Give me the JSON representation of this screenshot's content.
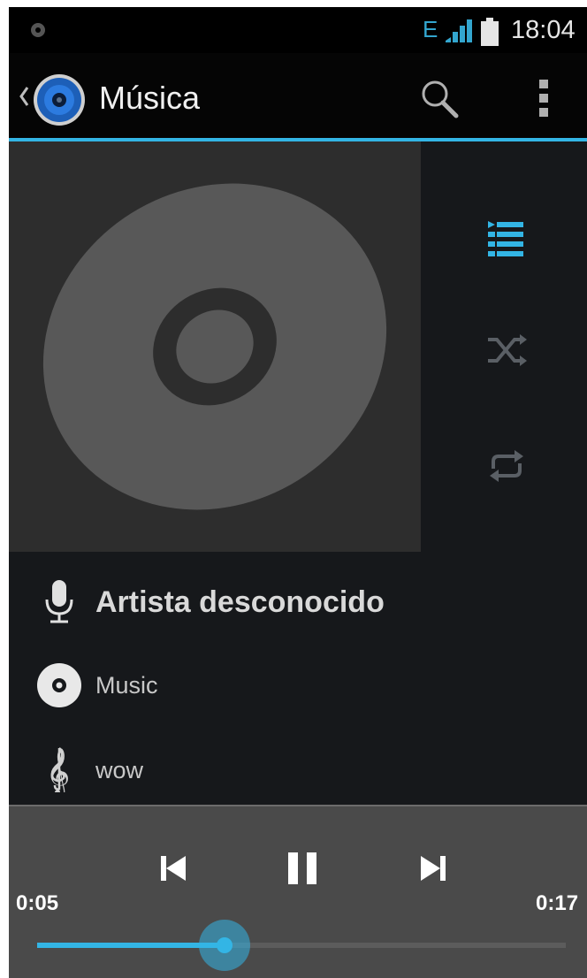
{
  "status_bar": {
    "network_type": "E",
    "time": "18:04"
  },
  "action_bar": {
    "title": "Música",
    "icons": [
      "back-chevron-icon",
      "music-app-icon",
      "search-icon",
      "overflow-menu-icon"
    ]
  },
  "side_controls": {
    "icons": [
      "now-playing-list-icon",
      "shuffle-icon",
      "repeat-icon"
    ]
  },
  "track": {
    "artist": "Artista desconocido",
    "album": "Music",
    "title": "wow"
  },
  "playback": {
    "current_time": "0:05",
    "total_time": "0:17",
    "progress": 0.355,
    "state": "playing",
    "icons": [
      "previous-icon",
      "pause-icon",
      "next-icon"
    ]
  },
  "colors": {
    "accent": "#33b5e5",
    "background": "#16181b",
    "panel": "#4a4a4a"
  }
}
